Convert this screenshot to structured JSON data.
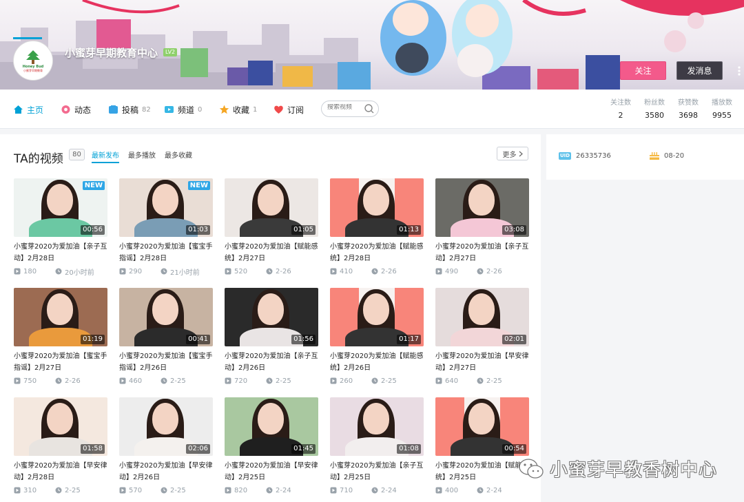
{
  "header": {
    "channel_name": "小蜜芽早期教育中心",
    "level": "LV2",
    "logo_text": "Honey Bud",
    "logo_sub": "小蜜芽早期教育",
    "follow_label": "关注",
    "message_label": "发消息"
  },
  "nav": {
    "items": [
      {
        "label": "主页",
        "count": "",
        "icon": "home-icon"
      },
      {
        "label": "动态",
        "count": "",
        "icon": "flower-icon"
      },
      {
        "label": "投稿",
        "count": "82",
        "icon": "upload-icon"
      },
      {
        "label": "频道",
        "count": "0",
        "icon": "channel-icon"
      },
      {
        "label": "收藏",
        "count": "1",
        "icon": "star-icon"
      },
      {
        "label": "订阅",
        "count": "",
        "icon": "heart-icon"
      }
    ],
    "search_placeholder": "搜索视频"
  },
  "stats": [
    {
      "label": "关注数",
      "value": "2"
    },
    {
      "label": "粉丝数",
      "value": "3580"
    },
    {
      "label": "获赞数",
      "value": "3698"
    },
    {
      "label": "播放数",
      "value": "9955"
    }
  ],
  "videos_section": {
    "title": "TA的视频",
    "count": "80",
    "sort_tabs": [
      "最新发布",
      "最多播放",
      "最多收藏"
    ],
    "more_label": "更多"
  },
  "profile": {
    "uid_label": "UID",
    "uid": "26335736",
    "birthday": "08-20"
  },
  "videos": [
    {
      "title": "小蜜芽2020为爱加油【亲子互动】2月28日",
      "duration": "00:56",
      "plays": "180",
      "time": "20小时前",
      "badge": "NEW"
    },
    {
      "title": "小蜜芽2020为爱加油【蜜宝手指谣】2月28日",
      "duration": "01:03",
      "plays": "290",
      "time": "21小时前",
      "badge": "NEW"
    },
    {
      "title": "小蜜芽2020为爱加油【赋能感统】2月27日",
      "duration": "01:05",
      "plays": "520",
      "time": "2-26",
      "badge": ""
    },
    {
      "title": "小蜜芽2020为爱加油【赋能感统】2月28日",
      "duration": "01:13",
      "plays": "410",
      "time": "2-26",
      "badge": ""
    },
    {
      "title": "小蜜芽2020为爱加油【亲子互动】2月27日",
      "duration": "03:08",
      "plays": "490",
      "time": "2-26",
      "badge": ""
    },
    {
      "title": "小蜜芽2020为爱加油【蜜宝手指谣】2月27日",
      "duration": "01:19",
      "plays": "750",
      "time": "2-26",
      "badge": ""
    },
    {
      "title": "小蜜芽2020为爱加油【蜜宝手指谣】2月26日",
      "duration": "00:41",
      "plays": "460",
      "time": "2-25",
      "badge": ""
    },
    {
      "title": "小蜜芽2020为爱加油【亲子互动】2月26日",
      "duration": "01:56",
      "plays": "720",
      "time": "2-25",
      "badge": ""
    },
    {
      "title": "小蜜芽2020为爱加油【赋能感统】2月26日",
      "duration": "01:17",
      "plays": "260",
      "time": "2-25",
      "badge": ""
    },
    {
      "title": "小蜜芽2020为爱加油【早安律动】2月27日",
      "duration": "02:01",
      "plays": "640",
      "time": "2-25",
      "badge": ""
    },
    {
      "title": "小蜜芽2020为爱加油【早安律动】2月28日",
      "duration": "01:58",
      "plays": "310",
      "time": "2-25",
      "badge": ""
    },
    {
      "title": "小蜜芽2020为爱加油【早安律动】2月26日",
      "duration": "02:06",
      "plays": "570",
      "time": "2-25",
      "badge": ""
    },
    {
      "title": "小蜜芽2020为爱加油【早安律动】2月25日",
      "duration": "01:45",
      "plays": "820",
      "time": "2-24",
      "badge": ""
    },
    {
      "title": "小蜜芽2020为爱加油【亲子互动】2月25日",
      "duration": "01:08",
      "plays": "710",
      "time": "2-24",
      "badge": ""
    },
    {
      "title": "小蜜芽2020为爱加油【赋能感统】2月25日",
      "duration": "00:54",
      "plays": "400",
      "time": "2-24",
      "badge": ""
    }
  ],
  "watermark": "小蜜芽早教香树中心",
  "colors": {
    "accent": "#00a1d6",
    "follow": "#f35a8b",
    "message": "#3d3b45"
  }
}
